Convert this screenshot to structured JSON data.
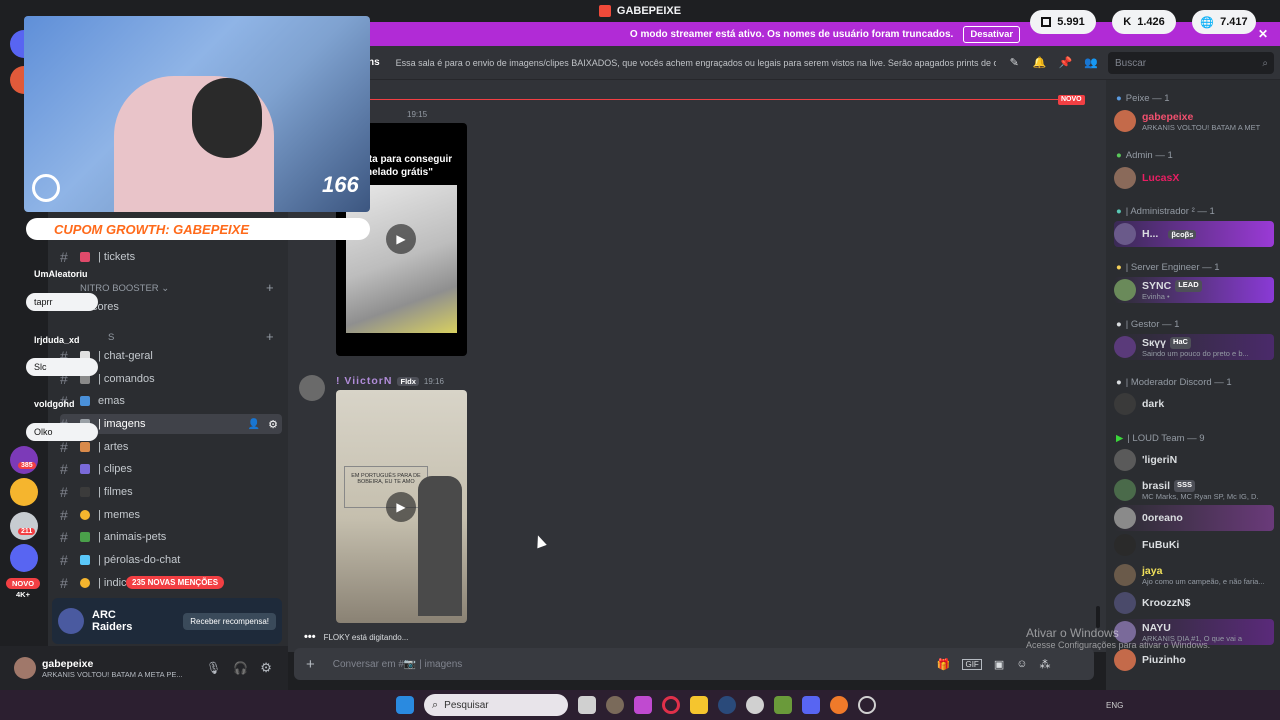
{
  "window": {
    "title": "GABEPEIXE"
  },
  "stats": {
    "twitch": "5.991",
    "kick": "1.426",
    "views": "7.417"
  },
  "banner": {
    "text": "O modo streamer está ativo. Os nomes de usuário foram truncados.",
    "button": "Desativar"
  },
  "header": {
    "tab_label": "ns",
    "topic": "Essa sala é para o envio de imagens/clipes BAIXADOS, que vocês achem engraçados ou legais para serem vistos na live. Serão apagados prints de o...",
    "search_placeholder": "Buscar"
  },
  "overlay": {
    "counter": "166",
    "coupon": "CUPOM GROWTH: GABEPEIXE",
    "chat": [
      {
        "user": "UmAleatoriu",
        "msg": "taprr"
      },
      {
        "user": "lrjduda_xd",
        "msg": "Slc"
      },
      {
        "user": "voldgohd",
        "msg": "Olko"
      }
    ]
  },
  "server_rail": {
    "badges": [
      "385",
      "211"
    ],
    "new_label": "NOVO",
    "more_label": "4K+"
  },
  "sidebar": {
    "channels_top": [
      {
        "name": "| tickets"
      }
    ],
    "category_nitro": "NITRO BOOSTER",
    "channel_cores": "cores",
    "category_s": "S",
    "channels": [
      {
        "name": "| chat-geral"
      },
      {
        "name": "| comandos"
      },
      {
        "name": "emas"
      },
      {
        "name": "| imagens"
      },
      {
        "name": "| artes"
      },
      {
        "name": "| clipes"
      },
      {
        "name": "| filmes"
      },
      {
        "name": "| memes"
      },
      {
        "name": "| animais-pets"
      },
      {
        "name": "| pérolas-do-chat"
      },
      {
        "name": "| indic"
      }
    ],
    "mentions_pill": "235 NOVAS MENÇÕES",
    "promo": {
      "title": "ARC Raiders",
      "button": "Receber recompensa!"
    }
  },
  "user_panel": {
    "name": "gabepeixe",
    "status": "ARKANIS VOLTOU! BATAM A META PE..."
  },
  "chat": {
    "new_label": "NOVO",
    "msg1": {
      "time": "19:15",
      "video_caption": "ita para conseguir helado grátis\""
    },
    "msg2": {
      "author": "! ViictorN",
      "tag": "Fldx",
      "time": "19:16",
      "video_caption": "EM PORTUGUÊS PARA DE BOBEIRA, EU TE AMO"
    },
    "typing": "FLOKY está digitando...",
    "composer_placeholder": "Conversar em #📷 | imagens"
  },
  "watermark": {
    "line1": "Ativar o Windows",
    "line2": "Acesse Configurações para ativar o Windows."
  },
  "members": {
    "groups": [
      {
        "role": "Peixe — 1",
        "members": [
          {
            "name": "gabepeixe",
            "sub": "ARKANIS VOLTOU! BATAM A MET",
            "color": "#f0506e"
          }
        ]
      },
      {
        "role": "Admin — 1",
        "members": [
          {
            "name": "LucasX",
            "sub": "",
            "color": "#e91e63"
          }
        ]
      },
      {
        "role": "| Administrador ² — 1",
        "members": [
          {
            "name": "H...",
            "sub": "",
            "tag": "βcoβs",
            "color": "#ffffff"
          }
        ]
      },
      {
        "role": "| Server Engineer — 1",
        "members": [
          {
            "name": "SYNC",
            "sub": "Evinha •",
            "tag": "LEAD",
            "color": "#ffffff"
          }
        ]
      },
      {
        "role": "| Gestor — 1",
        "members": [
          {
            "name": "Sкүү",
            "sub": "Saindo um pouco do preto e b...",
            "tag": "HaC",
            "color": "#ffffff"
          }
        ]
      },
      {
        "role": "| Moderador Discord — 1",
        "members": [
          {
            "name": "dark",
            "sub": "",
            "color": "#ffffff"
          }
        ]
      },
      {
        "role": "| LOUD Team — 9",
        "members": [
          {
            "name": "'ligeriN",
            "sub": "",
            "color": "#ffffff"
          },
          {
            "name": "brasil",
            "sub": "MC Marks, MC Ryan SP, Mc IG, D.",
            "tag": "SSS",
            "color": "#ffffff"
          },
          {
            "name": "0oreano",
            "sub": "",
            "color": "#ffffff"
          },
          {
            "name": "FuBuKi",
            "sub": "",
            "color": "#ffffff"
          },
          {
            "name": "jaya",
            "sub": "Ajo como um campeão, e não faria...",
            "color": "#f0e05a"
          },
          {
            "name": "KroozzN$",
            "sub": "",
            "color": "#ffffff"
          },
          {
            "name": "NAYU",
            "sub": "ARKANIS DIA #1, O que vai a",
            "color": "#ffffff"
          },
          {
            "name": "Piuzinho",
            "sub": "",
            "color": "#ffffff"
          }
        ]
      }
    ]
  },
  "taskbar": {
    "search_placeholder": "Pesquisar",
    "lang": "ENG"
  },
  "colors": {
    "accent": "#b12bd6",
    "danger": "#f23f43",
    "background": "#313338"
  }
}
